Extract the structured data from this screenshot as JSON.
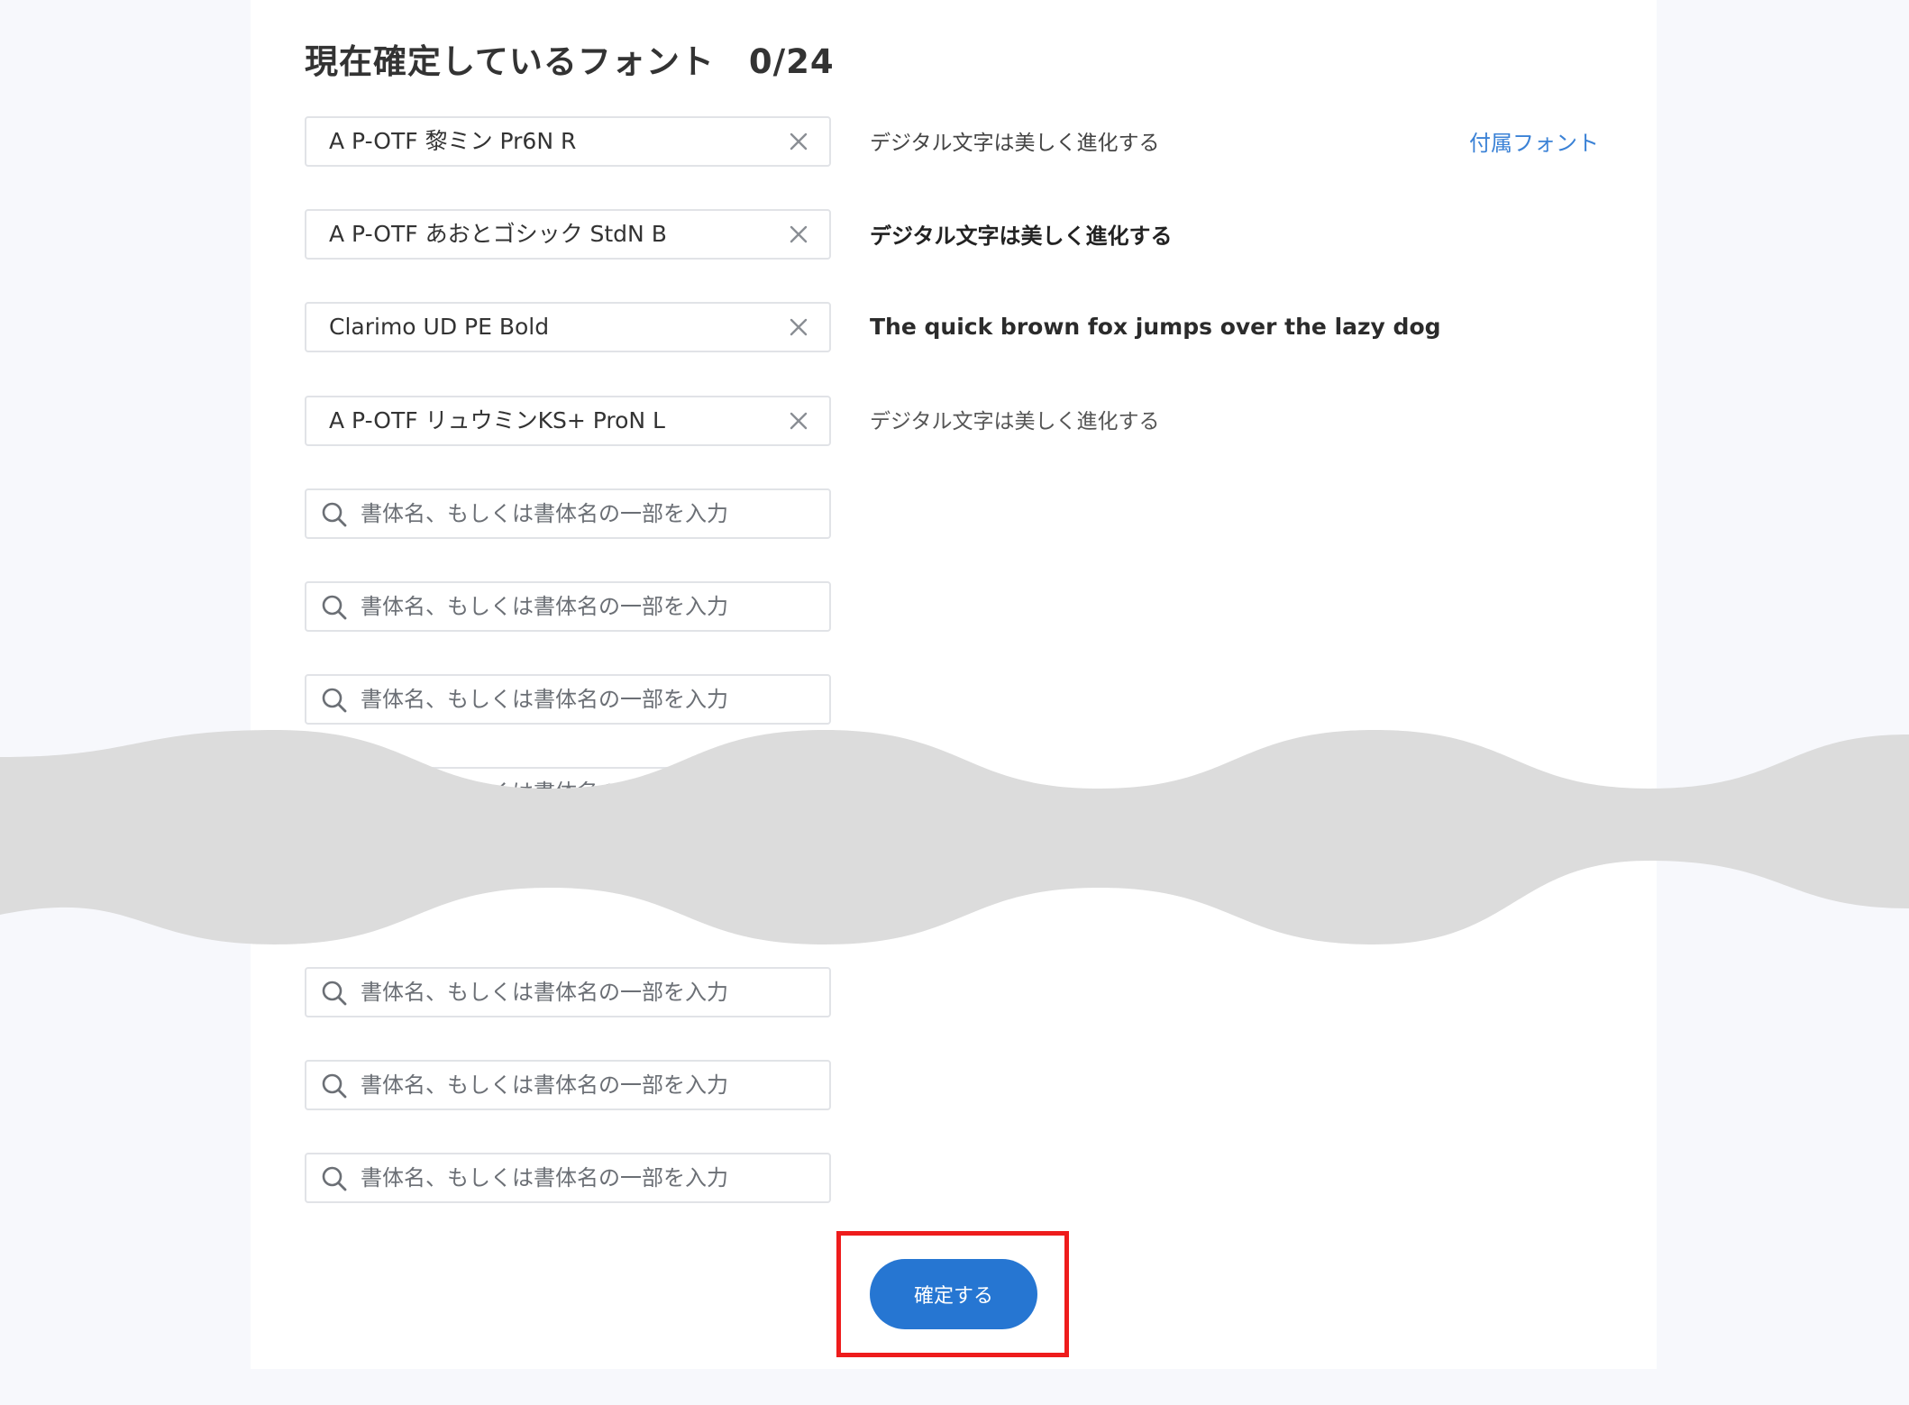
{
  "header": {
    "title": "現在確定しているフォント",
    "count": "0/24"
  },
  "selected_fonts": [
    {
      "name": "A P-OTF 黎ミン Pr6N R",
      "sample": "デジタル文字は美しく進化する",
      "clear_icon": "close-icon"
    },
    {
      "name": "A P-OTF あおとゴシック StdN B",
      "sample": "デジタル文字は美しく進化する",
      "clear_icon": "close-icon"
    },
    {
      "name": "Clarimo UD PE Bold",
      "sample": "The quick brown fox jumps over the lazy dog",
      "clear_icon": "close-icon"
    },
    {
      "name": "A P-OTF リュウミンKS+ ProN L",
      "sample": "デジタル文字は美しく進化する",
      "clear_icon": "close-icon"
    }
  ],
  "bundled_font_link": "付属フォント",
  "search": {
    "placeholder": "書体名、もしくは書体名の一部を入力",
    "icon": "search-icon"
  },
  "confirm_button": {
    "label": "確定する"
  },
  "colors": {
    "accent": "#2676d2",
    "link": "#3b82d6",
    "highlight": "#ee1c1c",
    "wave": "#dcdcdc"
  }
}
